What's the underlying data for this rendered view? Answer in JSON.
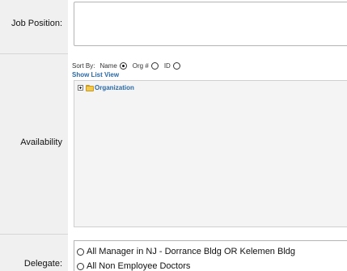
{
  "labels": {
    "job_position": "Job Position:",
    "availability": "Availability",
    "delegate": "Delegate:"
  },
  "sort": {
    "label": "Sort By:",
    "options": [
      {
        "label": "Name",
        "selected": true
      },
      {
        "label": "Org #",
        "selected": false
      },
      {
        "label": "ID",
        "selected": false
      }
    ]
  },
  "show_list_view": "Show List View",
  "tree": {
    "root": {
      "label": "Organization",
      "expanded": false,
      "icon": "folder-icon"
    }
  },
  "delegate_options": [
    {
      "label": "All Manager in NJ - Dorrance Bldg OR Kelemen Bldg",
      "selected": false
    },
    {
      "label": "All Non Employee Doctors",
      "selected": false
    }
  ],
  "colors": {
    "label_column": "#f0f0f0",
    "link": "#2a6aa8",
    "folder": "#f2c94c",
    "tree_background": "#f4f4f4"
  }
}
